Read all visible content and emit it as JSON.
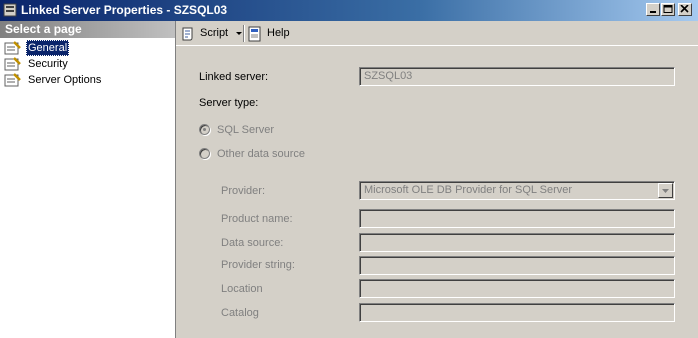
{
  "window": {
    "title": "Linked Server Properties - SZSQL03"
  },
  "left_pane": {
    "header": "Select a page",
    "items": [
      {
        "label": "General",
        "selected": true
      },
      {
        "label": "Security",
        "selected": false
      },
      {
        "label": "Server Options",
        "selected": false
      }
    ]
  },
  "toolbar": {
    "script_label": "Script",
    "help_label": "Help"
  },
  "form": {
    "linked_server_label": "Linked server:",
    "linked_server_value": "SZSQL03",
    "server_type_label": "Server type:",
    "sql_server_label": "SQL Server",
    "other_source_label": "Other data source",
    "provider_label": "Provider:",
    "provider_value": "Microsoft OLE DB Provider for SQL Server",
    "product_name_label": "Product name:",
    "data_source_label": "Data source:",
    "provider_string_label": "Provider string:",
    "location_label": "Location",
    "catalog_label": "Catalog"
  },
  "colors": {
    "titlebar": "#0a246a",
    "selection": "#0a246a",
    "face": "#d4d0c8"
  }
}
